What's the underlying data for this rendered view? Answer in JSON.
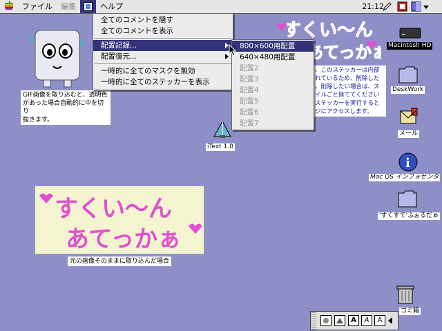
{
  "menubar": {
    "items": [
      {
        "label": "ファイル"
      },
      {
        "label": "編集"
      },
      {
        "label": ""
      },
      {
        "label": "ヘルプ"
      }
    ],
    "clock": "21:12"
  },
  "menu": {
    "items": [
      {
        "label": "全てのコメントを隠す"
      },
      {
        "label": "全てのコメントを表示"
      },
      {
        "label": "配置記録..."
      },
      {
        "label": "配置復元..."
      },
      {
        "label": "一時的に全てのマスクを無効"
      },
      {
        "label": "一時的に全てのステッカーを表示"
      }
    ],
    "submenu": [
      {
        "label": "800×600用配置",
        "state": "highlighted"
      },
      {
        "label": "640×480用配置",
        "state": "enabled"
      },
      {
        "label": "配置2",
        "state": "disabled"
      },
      {
        "label": "配置3",
        "state": "disabled"
      },
      {
        "label": "配置4",
        "state": "disabled"
      },
      {
        "label": "配置5",
        "state": "disabled"
      },
      {
        "label": "配置6",
        "state": "disabled"
      },
      {
        "label": "配置7",
        "state": "disabled"
      }
    ]
  },
  "desktop": {
    "icons": [
      {
        "label": "Macintosh HD"
      },
      {
        "label": "DeskWork"
      },
      {
        "label": "メール"
      },
      {
        "label": "Mac OS インフォセンタ"
      },
      {
        "label": "'すくすて'ふぉるだぁ"
      },
      {
        "label": "ゴミ箱"
      },
      {
        "label": "iText 1.0"
      }
    ],
    "notes": {
      "gif_note": [
        "GIF画像を取り込むと、透明色",
        "があった場合自動的に中を切り",
        "抜きます。"
      ],
      "sticker_note": [
        "。このステッカーは内部",
        "れているため、削除した",
        "。削除したい場合は、ス",
        "イルごと捨ててください",
        "ステッカーを実行すると",
        "ジにアクセスします。"
      ],
      "original_caption": "元の画像そのままに取り込んだ場合"
    },
    "sticker_text": {
      "line1": "すくい〜ん",
      "line2": "あてっかぁ"
    }
  },
  "palette": {
    "buttons": [
      "A",
      "A",
      "A"
    ]
  },
  "colors": {
    "desktop": "#8f8fc8",
    "highlight": "#33337a",
    "menubar": "#e6e6e6"
  }
}
